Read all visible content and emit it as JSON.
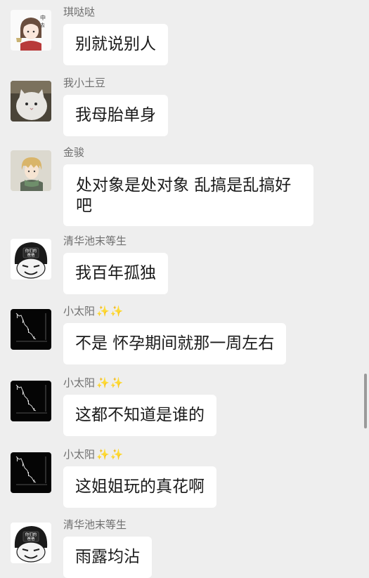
{
  "messages": [
    {
      "sender": "琪哒哒",
      "text": "别就说别人",
      "avatar": "anime-girl-avatar"
    },
    {
      "sender": "我小土豆",
      "text": "我母胎单身",
      "avatar": "fluffy-cat-avatar"
    },
    {
      "sender": "金骏",
      "text": "处对象是处对象 乱搞是乱搞好吧",
      "avatar": "anime-boy-scarf-avatar"
    },
    {
      "sender": "清华池末等生",
      "text": "我百年孤独",
      "avatar": "meme-face-helmet-avatar",
      "avatar_text": "你们的\n爸爸"
    },
    {
      "sender": "小太阳",
      "sender_suffix": "✨✨",
      "text": "不是 怀孕期间就那一周左右",
      "avatar": "stock-chart-avatar"
    },
    {
      "sender": "小太阳",
      "sender_suffix": "✨✨",
      "text": "这都不知道是谁的",
      "avatar": "stock-chart-avatar"
    },
    {
      "sender": "小太阳",
      "sender_suffix": "✨✨",
      "text": "这姐姐玩的真花啊",
      "avatar": "stock-chart-avatar"
    },
    {
      "sender": "清华池末等生",
      "text": "雨露均沾",
      "avatar": "meme-face-helmet-avatar",
      "avatar_text": "你们的\n爸爸"
    }
  ],
  "colors": {
    "background": "#eeeeee",
    "bubble": "#ffffff",
    "sender_name": "#6f6f6f",
    "sparkle": "#e0b82b"
  }
}
